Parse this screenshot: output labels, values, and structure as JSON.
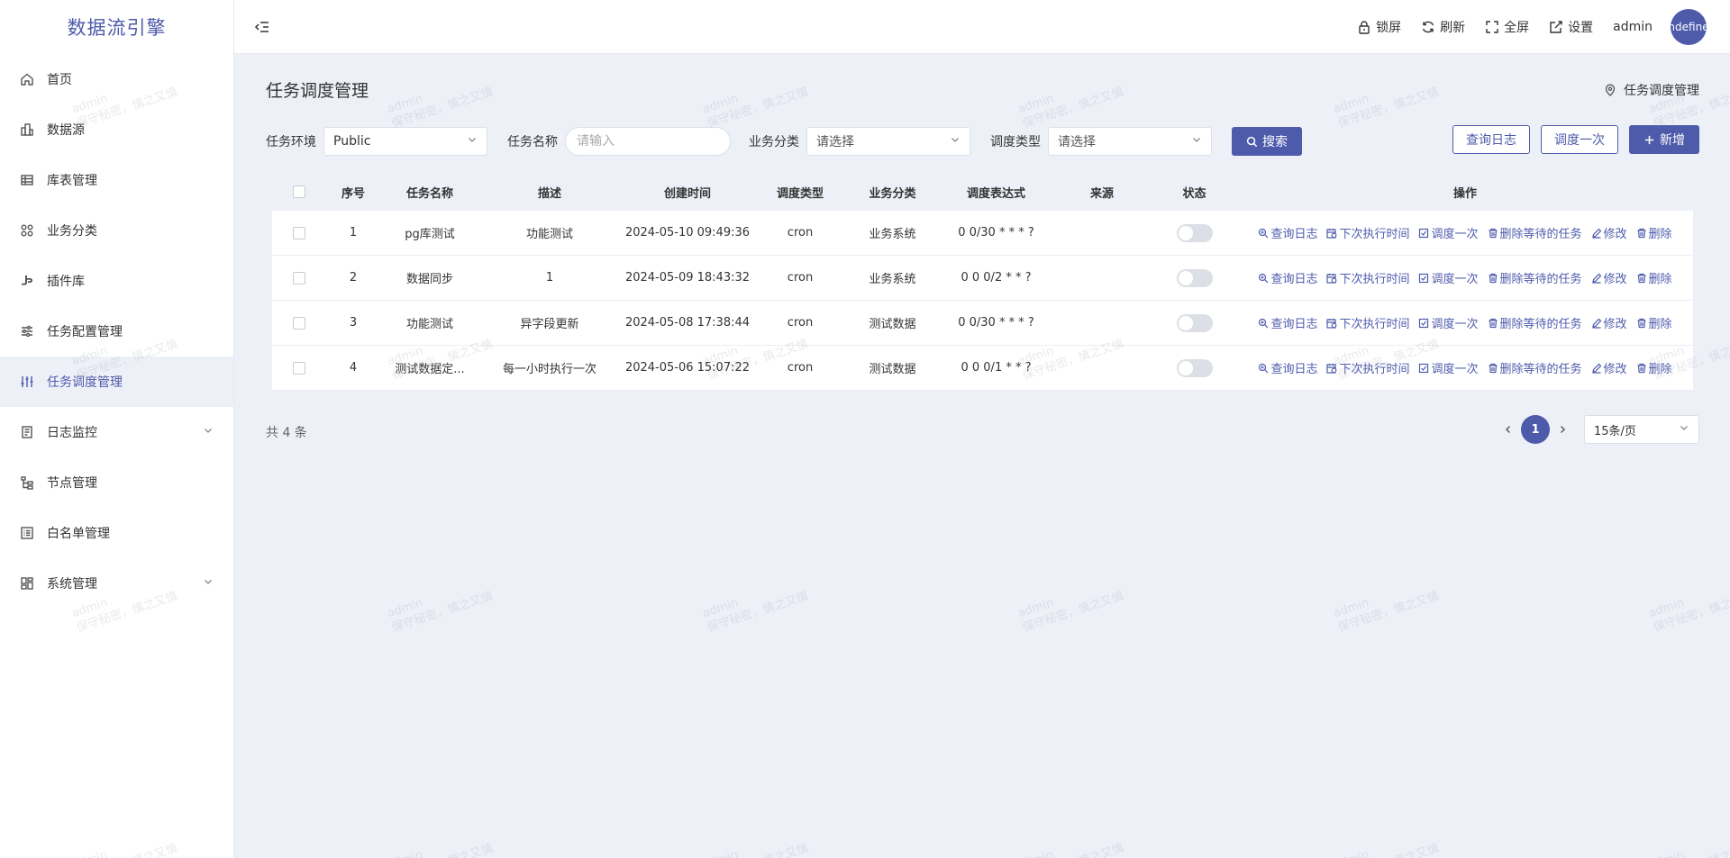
{
  "app": {
    "title": "数据流引擎"
  },
  "sidebar": {
    "items": [
      {
        "label": "首页",
        "icon": "home-icon"
      },
      {
        "label": "数据源",
        "icon": "database-icon"
      },
      {
        "label": "库表管理",
        "icon": "table-icon"
      },
      {
        "label": "业务分类",
        "icon": "category-icon"
      },
      {
        "label": "插件库",
        "icon": "plugin-icon"
      },
      {
        "label": "任务配置管理",
        "icon": "sliders-icon"
      },
      {
        "label": "任务调度管理",
        "icon": "schedule-icon",
        "active": true
      },
      {
        "label": "日志监控",
        "icon": "log-icon",
        "expandable": true
      },
      {
        "label": "节点管理",
        "icon": "tree-icon"
      },
      {
        "label": "白名单管理",
        "icon": "list-icon"
      },
      {
        "label": "系统管理",
        "icon": "grid-icon",
        "expandable": true
      }
    ]
  },
  "header": {
    "lock": "锁屏",
    "refresh": "刷新",
    "fullscreen": "全屏",
    "settings": "设置",
    "user": "admin",
    "avatar_text": "undefined"
  },
  "page": {
    "title": "任务调度管理",
    "breadcrumb": "任务调度管理"
  },
  "filters": {
    "env_label": "任务环境",
    "env_value": "Public",
    "name_label": "任务名称",
    "name_placeholder": "请输入",
    "category_label": "业务分类",
    "category_value": "请选择",
    "type_label": "调度类型",
    "type_value": "请选择",
    "search_button": "搜索"
  },
  "actions": {
    "query_log": "查询日志",
    "run_once": "调度一次",
    "add": "新增"
  },
  "table": {
    "columns": [
      "序号",
      "任务名称",
      "描述",
      "创建时间",
      "调度类型",
      "业务分类",
      "调度表达式",
      "来源",
      "状态",
      "操作"
    ],
    "rows": [
      {
        "no": "1",
        "name": "pg库测试",
        "desc": "功能测试",
        "time": "2024-05-10 09:49:36",
        "type": "cron",
        "category": "业务系统",
        "expr": "0 0/30 * * * ?",
        "source": "",
        "enabled": false
      },
      {
        "no": "2",
        "name": "数据同步",
        "desc": "1",
        "time": "2024-05-09 18:43:32",
        "type": "cron",
        "category": "业务系统",
        "expr": "0 0 0/2 * * ?",
        "source": "",
        "enabled": false
      },
      {
        "no": "3",
        "name": "功能测试",
        "desc": "异字段更新",
        "time": "2024-05-08 17:38:44",
        "type": "cron",
        "category": "测试数据",
        "expr": "0 0/30 * * * ?",
        "source": "",
        "enabled": false
      },
      {
        "no": "4",
        "name": "测试数据定...",
        "desc": "每一小时执行一次",
        "time": "2024-05-06 15:07:22",
        "type": "cron",
        "category": "测试数据",
        "expr": "0 0 0/1 * * ?",
        "source": "",
        "enabled": false
      }
    ],
    "ops": {
      "query_log": "查询日志",
      "next_time": "下次执行时间",
      "run_once": "调度一次",
      "delete_pending": "删除等待的任务",
      "edit": "修改",
      "delete": "删除"
    }
  },
  "pagination": {
    "total": "共 4 条",
    "current": "1",
    "page_size": "15条/页"
  },
  "watermark": {
    "line1": "admin",
    "line2": "保守秘密，慎之又慎"
  },
  "colors": {
    "primary": "#4e5bab",
    "background": "#eef0f7"
  }
}
